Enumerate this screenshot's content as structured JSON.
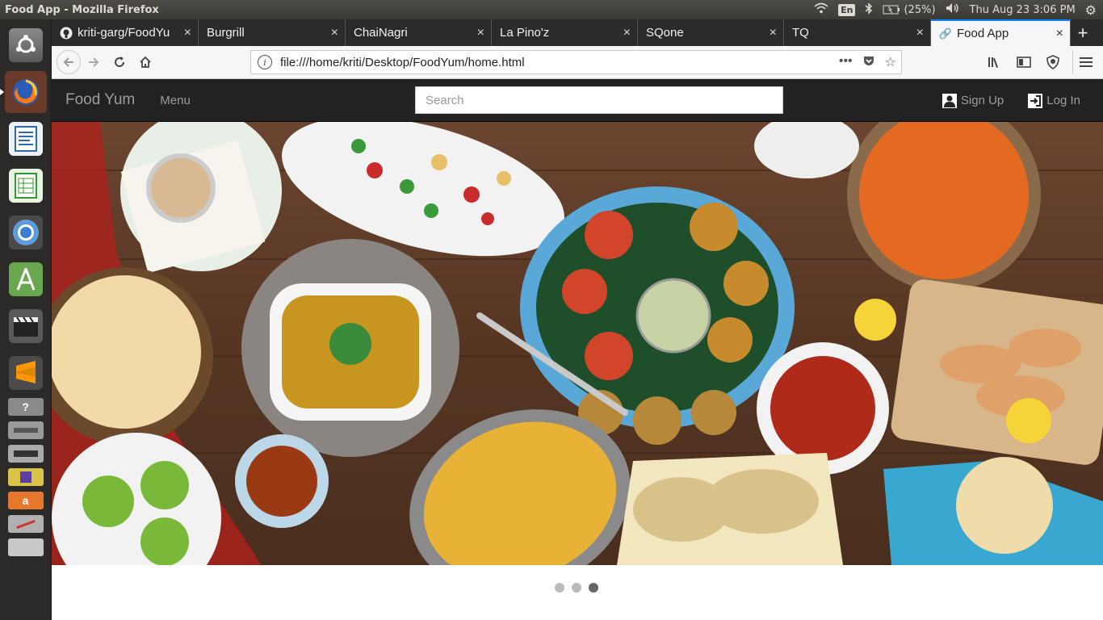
{
  "os_panel": {
    "window_title": "Food App - Mozilla Firefox",
    "keyboard_layout": "En",
    "battery": "(25%)",
    "clock": "Thu Aug 23  3:06 PM"
  },
  "launcher": {
    "items": [
      "ubuntu-dash",
      "firefox",
      "writer",
      "calc",
      "chromium",
      "android-studio",
      "video-editor",
      "sublime-text",
      "help",
      "drive",
      "drive",
      "app",
      "amazon",
      "app",
      "app"
    ]
  },
  "browser": {
    "tabs": [
      {
        "label": "kriti-garg/FoodYu",
        "icon": "github-icon"
      },
      {
        "label": "Burgrill"
      },
      {
        "label": "ChaiNagri"
      },
      {
        "label": "La Pino'z"
      },
      {
        "label": "SQone"
      },
      {
        "label": "TQ"
      },
      {
        "label": "Food App",
        "icon": "link-icon",
        "active": true
      }
    ],
    "url": "file:///home/kriti/Desktop/FoodYum/home.html",
    "new_tab_symbol": "+",
    "close_symbol": "×"
  },
  "site": {
    "brand": "Food Yum",
    "menu_label": "Menu",
    "search_placeholder": "Search",
    "signup_label": "Sign Up",
    "login_label": "Log In",
    "carousel": {
      "slide_count": 3,
      "active_index": 2
    }
  }
}
